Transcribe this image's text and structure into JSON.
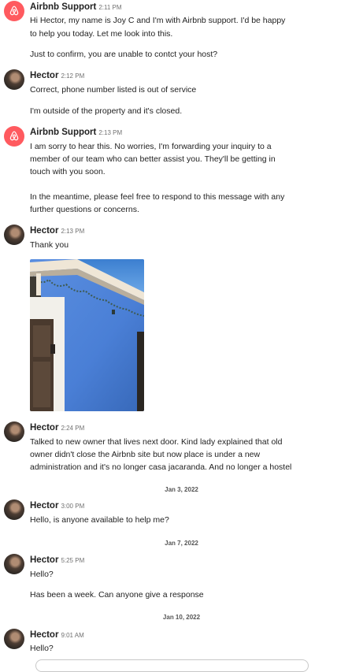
{
  "messages": [
    {
      "sender": "Airbnb Support",
      "time": "2:11 PM",
      "avatar": "airbnb-logo-icon",
      "lines": [
        "Hi Hector, my name is Joy C and I'm with Airbnb support. I'd be happy",
        "to help you today. Let me look into this.",
        "Just to confirm, you are unable to contct your host?"
      ]
    },
    {
      "sender": "Hector",
      "time": "2:12 PM",
      "avatar": "user-avatar",
      "lines": [
        "Correct, phone number listed is out of service",
        "I'm outside of the property and it's closed."
      ]
    },
    {
      "sender": "Airbnb Support",
      "time": "2:13 PM",
      "avatar": "airbnb-logo-icon",
      "lines": [
        "I am sorry to hear this. No worries, I'm forwarding your inquiry to a",
        "member of our team who can better assist you. They'll be getting in",
        "touch with you soon.",
        "In the meantime, please feel free to respond to this message with any",
        "further questions or concerns."
      ]
    },
    {
      "sender": "Hector",
      "time": "2:13 PM",
      "avatar": "user-avatar",
      "lines": [
        "Thank you"
      ],
      "attachment": "photo"
    },
    {
      "sender": "Hector",
      "time": "2:24 PM",
      "avatar": "user-avatar",
      "lines": [
        "Talked to new owner that lives next door. Kind lady explained that old",
        "owner didn't close the Airbnb site but now place is under a new",
        "administration and it's no longer casa jacaranda. And no longer a hostel"
      ]
    },
    {
      "sender": "Hector",
      "time": "3:00 PM",
      "avatar": "user-avatar",
      "lines": [
        "Hello, is anyone available to help me?"
      ]
    },
    {
      "sender": "Hector",
      "time": "5:25 PM",
      "avatar": "user-avatar",
      "lines": [
        "Hello?",
        "Has been a week. Can anyone give a response"
      ]
    },
    {
      "sender": "Hector",
      "time": "9:01 AM",
      "avatar": "user-avatar",
      "lines": [
        "Hello?"
      ]
    }
  ],
  "date_separators": [
    "Jan 3, 2022",
    "Jan 7, 2022",
    "Jan 10, 2022"
  ],
  "colors": {
    "airbnb_brand": "#ff5a5f",
    "wall_blue": "#4a7fd6",
    "text": "#222222",
    "meta": "#717171"
  }
}
